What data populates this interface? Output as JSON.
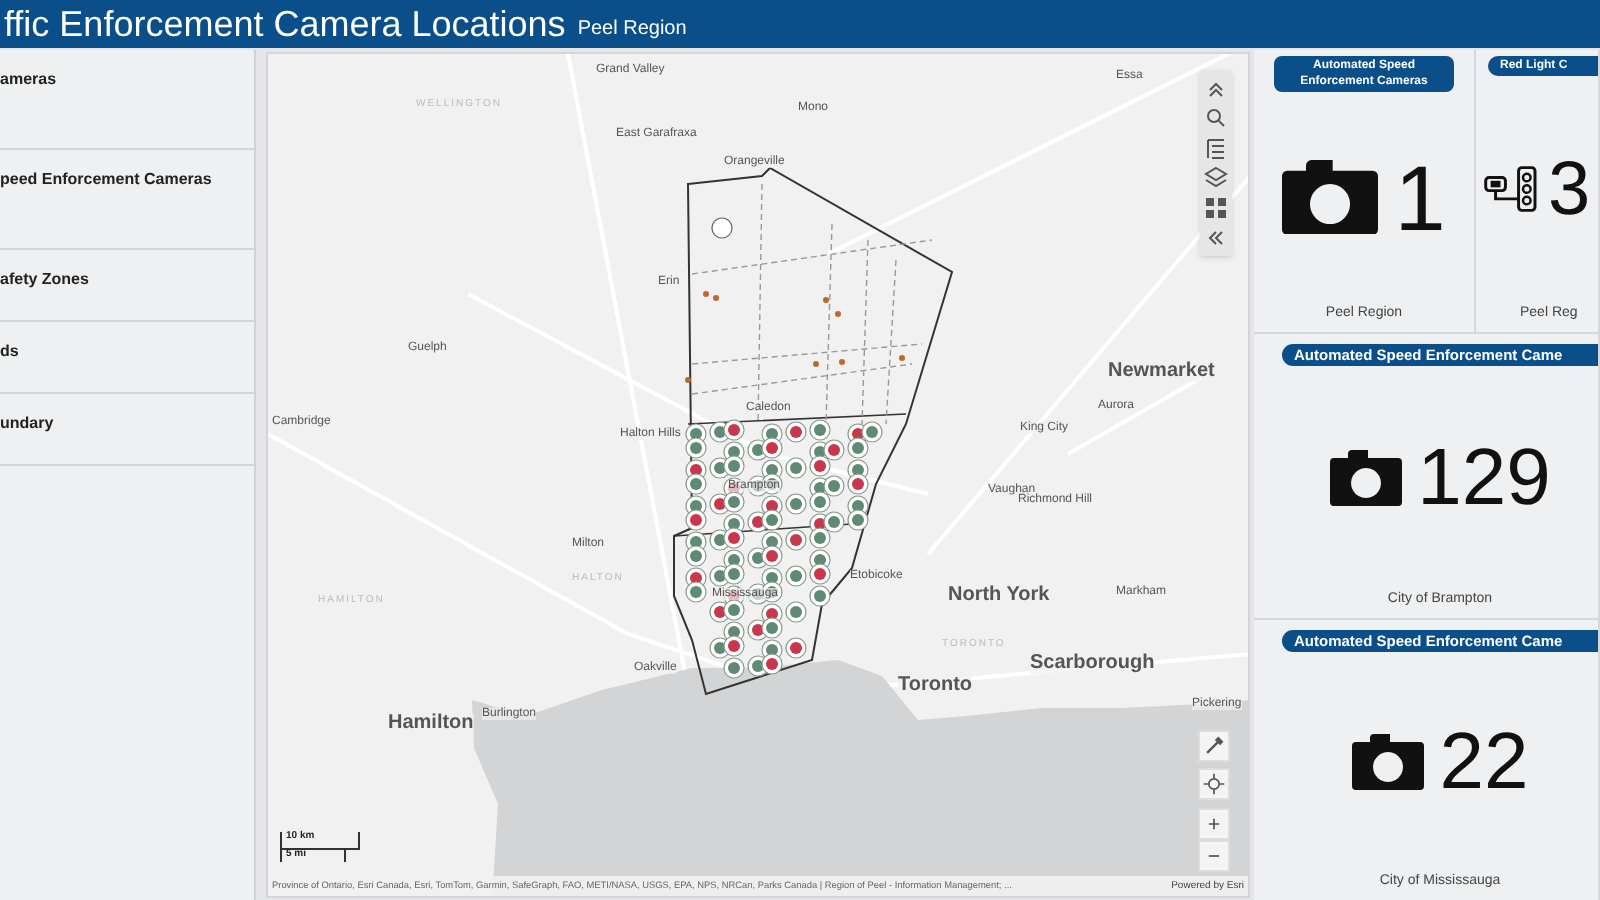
{
  "header": {
    "title": "ffic Enforcement Camera Locations",
    "subtitle": "Peel Region"
  },
  "sidebar": {
    "layers": [
      "ameras",
      "peed Enforcement Cameras",
      "afety Zones",
      "ds",
      "undary"
    ]
  },
  "map": {
    "labels": [
      {
        "text": "Grand Valley",
        "kind": "town"
      },
      {
        "text": "Essa",
        "kind": "town"
      },
      {
        "text": "WELLINGTON",
        "kind": "region"
      },
      {
        "text": "Mono",
        "kind": "town"
      },
      {
        "text": "East Garafraxa",
        "kind": "town"
      },
      {
        "text": "Orangeville",
        "kind": "town"
      },
      {
        "text": "Erin",
        "kind": "town"
      },
      {
        "text": "Guelph",
        "kind": "town"
      },
      {
        "text": "Newmarket",
        "kind": "city"
      },
      {
        "text": "Caledon",
        "kind": "town"
      },
      {
        "text": "Aurora",
        "kind": "town"
      },
      {
        "text": "Cambridge",
        "kind": "town"
      },
      {
        "text": "Halton Hills",
        "kind": "town"
      },
      {
        "text": "King City",
        "kind": "town"
      },
      {
        "text": "Brampton",
        "kind": "town"
      },
      {
        "text": "Vaughan",
        "kind": "town"
      },
      {
        "text": "Richmond Hill",
        "kind": "town"
      },
      {
        "text": "Milton",
        "kind": "town"
      },
      {
        "text": "HALTON",
        "kind": "region"
      },
      {
        "text": "Etobicoke",
        "kind": "town"
      },
      {
        "text": "HAMILTON",
        "kind": "region"
      },
      {
        "text": "Mississauga",
        "kind": "town"
      },
      {
        "text": "North York",
        "kind": "city"
      },
      {
        "text": "Markham",
        "kind": "town"
      },
      {
        "text": "TORONTO",
        "kind": "region"
      },
      {
        "text": "Oakville",
        "kind": "town"
      },
      {
        "text": "Scarborough",
        "kind": "city"
      },
      {
        "text": "Toronto",
        "kind": "city"
      },
      {
        "text": "Hamilton",
        "kind": "city"
      },
      {
        "text": "Burlington",
        "kind": "town"
      },
      {
        "text": "Pickering",
        "kind": "town"
      }
    ],
    "scale": {
      "metric": "10 km",
      "imperial": "5 mi"
    },
    "attribution": "Province of Ontario, Esri Canada, Esri, TomTom, Garmin, SafeGraph, FAO, METI/NASA, USGS, EPA, NPS, NRCan, Parks Canada | Region of Peel - Information Management; ...",
    "powered_by": "Powered by Esri"
  },
  "indicators": [
    {
      "title": "Automated Speed Enforcement Cameras",
      "value": "1",
      "caption": "Peel Region",
      "kind": "speed"
    },
    {
      "title": "Red Light C",
      "value": "3",
      "caption": "Peel Reg",
      "kind": "redlight"
    },
    {
      "title": "Automated Speed Enforcement Came",
      "value": "129",
      "caption": "City of Brampton",
      "kind": "speed"
    },
    {
      "title": "Automated Speed Enforcement Came",
      "value": "22",
      "caption": "City of Mississauga",
      "kind": "speed"
    }
  ]
}
